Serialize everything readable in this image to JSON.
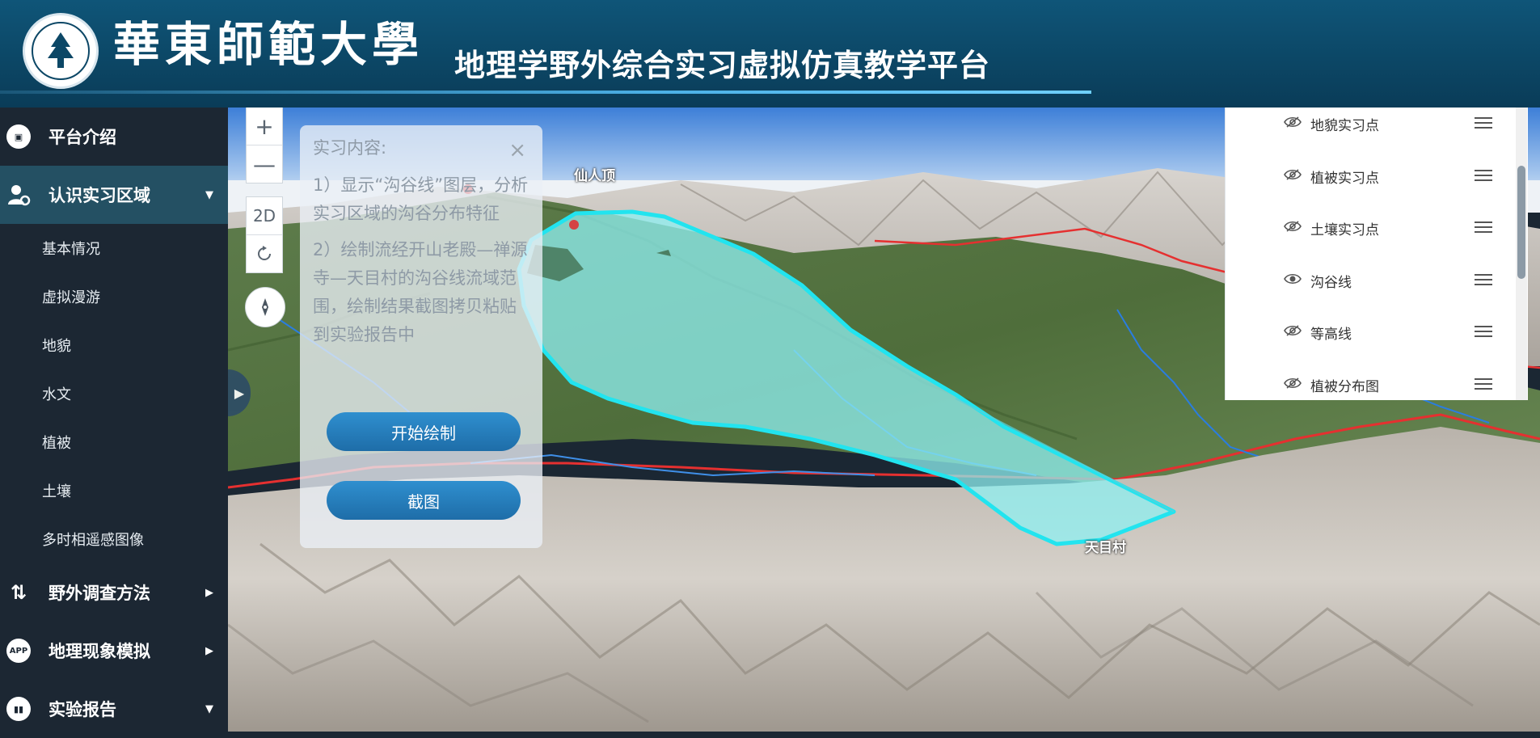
{
  "header": {
    "school_name": "華東師範大學",
    "platform_title": "地理学野外综合实习虚拟仿真教学平台"
  },
  "sidebar": {
    "items": [
      {
        "label": "平台介绍",
        "icon": "monitor-icon"
      },
      {
        "label": "认识实习区域",
        "icon": "user-settings-icon",
        "expanded": true
      },
      {
        "label": "野外调查方法",
        "icon": "route-icon"
      },
      {
        "label": "地理现象模拟",
        "icon": "app-icon"
      },
      {
        "label": "实验报告",
        "icon": "bar-chart-icon"
      }
    ],
    "subitems": [
      "基本情况",
      "虚拟漫游",
      "地貌",
      "水文",
      "植被",
      "土壤",
      "多时相遥感图像"
    ]
  },
  "map": {
    "zoom_in": "+",
    "zoom_out": "—",
    "view_mode": "2D",
    "labels": {
      "peak": "仙人顶",
      "village": "天目村"
    }
  },
  "task_panel": {
    "title": "实习内容:",
    "close": "×",
    "item1": "1）显示“沟谷线”图层，分析实习区域的沟谷分布特征",
    "item2": "2）绘制流经开山老殿—禅源寺—天目村的沟谷线流域范围，绘制结果截图拷贝粘贴到实验报告中",
    "start_button": "开始绘制",
    "screenshot_button": "截图"
  },
  "layers": [
    {
      "name": "地貌实习点",
      "visible": false
    },
    {
      "name": "植被实习点",
      "visible": false
    },
    {
      "name": "土壤实习点",
      "visible": false
    },
    {
      "name": "沟谷线",
      "visible": true
    },
    {
      "name": "等高线",
      "visible": false
    },
    {
      "name": "植被分布图",
      "visible": false
    }
  ],
  "colors": {
    "header": "#0c4766",
    "sidebar": "#1c2733",
    "active": "#245063",
    "accent": "#1e6da8",
    "basin": "#7fe6ec"
  }
}
